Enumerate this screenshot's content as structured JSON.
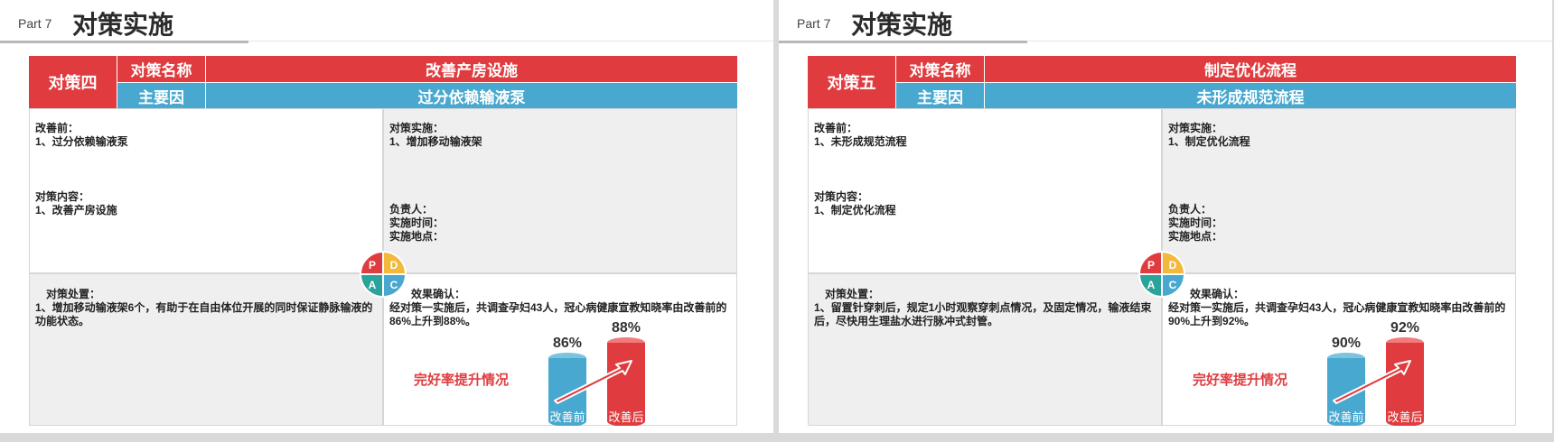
{
  "slides": [
    {
      "part": "Part 7",
      "title": "对策实施",
      "code": "对策四",
      "label_name": "对策名称",
      "name": "改善产房设施",
      "label_cause": "主要因",
      "cause": "过分依赖输液泵",
      "before_label": "改善前：",
      "before": "1、过分依赖输液泵",
      "content_label": "对策内容：",
      "content": "1、改善产房设施",
      "impl_label": "对策实施：",
      "impl": "1、增加移动输液架",
      "owner_label": "负责人：",
      "time_label": "实施时间：",
      "place_label": "实施地点：",
      "handle_label": "对策处置：",
      "handle": "1、增加移动输液架6个，有助于在自由体位开展的同时保证静脉输液的功能状态。",
      "effect_label": "效果确认：",
      "effect": "经对策一实施后，共调查孕妇43人，冠心病健康宣教知晓率由改善前的86%上升到88%。",
      "chart_title": "完好率提升情况",
      "before_pct": "86%",
      "after_pct": "88%",
      "before_bar": "改善前",
      "after_bar": "改善后"
    },
    {
      "part": "Part 7",
      "title": "对策实施",
      "code": "对策五",
      "label_name": "对策名称",
      "name": "制定优化流程",
      "label_cause": "主要因",
      "cause": "未形成规范流程",
      "before_label": "改善前：",
      "before": "1、未形成规范流程",
      "content_label": "对策内容：",
      "content": "1、制定优化流程",
      "impl_label": "对策实施：",
      "impl": "1、制定优化流程",
      "owner_label": "负责人：",
      "time_label": "实施时间：",
      "place_label": "实施地点：",
      "handle_label": "对策处置：",
      "handle": "1、留置针穿刺后，规定1小时观察穿刺点情况，及固定情况，输液结束后，尽快用生理盐水进行脉冲式封管。",
      "effect_label": "效果确认：",
      "effect": "经对策一实施后，共调查孕妇43人，冠心病健康宣教知晓率由改善前的90%上升到92%。",
      "chart_title": "完好率提升情况",
      "before_pct": "90%",
      "after_pct": "92%",
      "before_bar": "改善前",
      "after_bar": "改善后"
    }
  ],
  "pdca": {
    "p": "P",
    "d": "D",
    "c": "C",
    "a": "A"
  },
  "colors": {
    "red": "#e03c3f",
    "blue": "#48a8d0",
    "yellow": "#f2b93b",
    "teal": "#2aa39a"
  }
}
